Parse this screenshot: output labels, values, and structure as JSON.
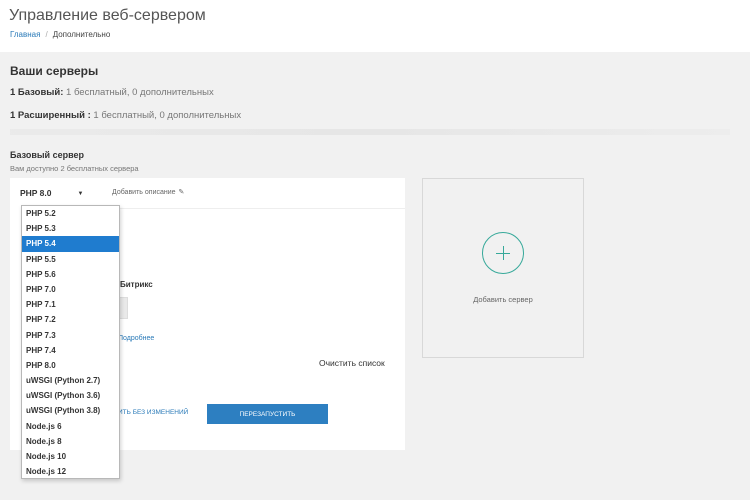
{
  "header": {
    "title": "Управление веб-сервером",
    "breadcrumb": {
      "home": "Главная",
      "separator": "/",
      "current": "Дополнительно"
    }
  },
  "servers": {
    "title": "Ваши серверы",
    "plans": [
      {
        "name": "1 Базовый:",
        "detail": " 1 бесплатный, 0 дополнительных"
      },
      {
        "name": "1 Расширенный :",
        "detail": " 1 бесплатный, 0 дополнительных"
      }
    ]
  },
  "base_server": {
    "title": "Базовый сервер",
    "subtitle": "Вам доступно 2 бесплатных сервера",
    "selected_version": "PHP 8.0",
    "add_description": "Добавить описание",
    "bitrix_label": "Битрикс",
    "more_link": "Подробнее",
    "clear_list": "Очистить список",
    "save_nochange": "ить без изменений",
    "restart_button": "Перезапустить"
  },
  "dropdown": {
    "selected_index": 2,
    "options": [
      "PHP 5.2",
      "PHP 5.3",
      "PHP 5.4",
      "PHP 5.5",
      "PHP 5.6",
      "PHP 7.0",
      "PHP 7.1",
      "PHP 7.2",
      "PHP 7.3",
      "PHP 7.4",
      "PHP 8.0",
      "uWSGI (Python 2.7)",
      "uWSGI (Python 3.6)",
      "uWSGI (Python 3.8)",
      "Node.js 6",
      "Node.js 8",
      "Node.js 10",
      "Node.js 12"
    ]
  },
  "add_server": {
    "label": "Добавить сервер"
  },
  "colors": {
    "accent": "#2d7fc1",
    "selected": "#1f7ccf",
    "plus": "#37a99a",
    "link": "#2a7ab8"
  },
  "icons": {
    "caret": "caret-down-icon",
    "pencil": "pencil-icon",
    "plus": "plus-circle-icon"
  }
}
